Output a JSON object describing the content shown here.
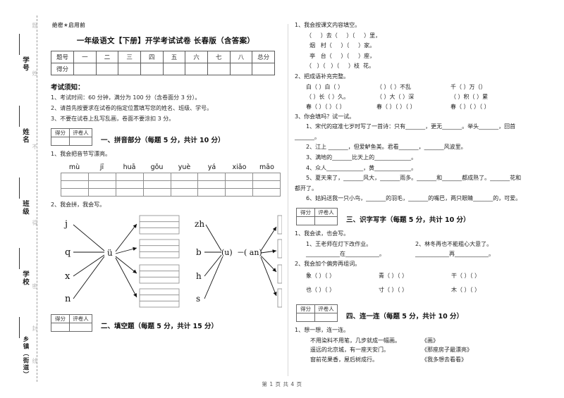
{
  "document": {
    "secret_mark": "绝密★启用前",
    "title": "一年级语文【下册】开学考试试卷 长春版（含答案）",
    "footer": "第 1 页 共 4 页"
  },
  "seal_column": {
    "labels": [
      "学号",
      "姓名",
      "班级",
      "学校",
      "乡镇（街道）"
    ],
    "faint": [
      "题",
      "姓",
      "不",
      "得",
      "密",
      "封",
      "线",
      "内",
      "答"
    ]
  },
  "score_table": {
    "row_labels": [
      "题号",
      "得分"
    ],
    "columns": [
      "一",
      "二",
      "三",
      "四",
      "五",
      "六",
      "七",
      "八",
      "总分"
    ]
  },
  "notice": {
    "title": "考试须知：",
    "items": [
      "1、考试时间：60 分钟，满分为 100 分（含卷面分 3 分）。",
      "2、请首先按要求在试卷的指定位置填写您的姓名、班级、学号。",
      "3、不要在试卷上乱写乱画，卷面不要涂扣 3 分。"
    ]
  },
  "grader_box": {
    "score_label": "得分",
    "grader_label": "评卷人"
  },
  "sections": [
    {
      "id": "s1",
      "title": "一、拼音部分（每题 5 分，共计 10 分）",
      "q1_label": "1、我会把音节写漂亮。",
      "pinyin": [
        "mù",
        "jī",
        "huā",
        "gǒu",
        "yuè",
        "yá",
        "xiǎo",
        "māo"
      ],
      "grid_cols": 8,
      "grid_rows": 3,
      "q2_label": "2、我会拼，我会写。",
      "diagram": {
        "left_group": {
          "initials": [
            "j",
            "q",
            "x",
            "n"
          ],
          "final": "ü",
          "boxes": 4
        },
        "right_group": {
          "initials": [
            "zh",
            "b",
            "h",
            "s"
          ],
          "middle": "(u)",
          "dash": "－",
          "final": "( an)",
          "boxes": 4
        }
      }
    },
    {
      "id": "s2",
      "title": "二、填空题（每题 5 分，共计 15 分）"
    },
    {
      "id": "s3",
      "title": "三、识字写字（每题 5 分，共计 10 分）",
      "q1_label": "1、我会读，也会写。",
      "sentences": [
        {
          "num": "1、",
          "text": "王老师在灯下改作业。",
          "blank": "____________在____________。"
        },
        {
          "num": "2、",
          "text": "林冬再也不能粗心大意了。",
          "blank": "____________再____________。"
        }
      ],
      "q2_label": "2、我会加个偏旁再组词。",
      "radical_rows": [
        [
          "象（  ）（      ）",
          "青（  ）（      ）",
          "干（  ）（      ）"
        ],
        [
          "也（  ）（      ）",
          "寸（  ）（      ）",
          "木（  ）（      ）"
        ]
      ]
    },
    {
      "id": "s4",
      "title": "四、连一连（每题 5 分，共计 10 分）",
      "q1_label": "1、想一想，连一连。",
      "pairs": [
        {
          "left": "不用染料不用笔，几步就成一幅画。",
          "right": "《画》"
        },
        {
          "left": "遥远的北京城，有一座天安门。",
          "right": "《那座房子最漂亮》"
        },
        {
          "left": "窗前花果香，屋后树成行。",
          "right": "《我多想去看看》"
        }
      ]
    }
  ],
  "right_column": {
    "q1_label": "1、我会按课文内容填空。",
    "poem_lines": [
      "（     ）去（     ）（     ）里，",
      "  烟   村（     ）（     ）家。",
      "  亭   台（     ）（     ）座，",
      "（   ）（   ）（     ）枝  花。"
    ],
    "q2_label": "2、把成语补充完整。",
    "idiom_rows": [
      [
        "白（  ）白（  ）",
        "（  ）（  ）不乱",
        "千（  ）万（）"
      ],
      [
        "（  ）长（  ）久。",
        "（  ）大（  ）深",
        "（  ）积（  ）累"
      ],
      [
        "春（  ）（  ）（  ）",
        "春（  ）（  ）（  ）",
        "春（  ）（  ）（  ）"
      ]
    ],
    "q3_label": "3、你会填吗？试一试。",
    "fill_items": [
      "1、宋代的寇准七岁时写了一首诗：只有_______，更无_______。举头_______，回首",
      "_______。",
      "2、江上 _______，但爱鲈鱼美。君看_______，_______风波里。",
      "3、满地的_______比天上的_____________。",
      "4、众人_____________，黄_____________。",
      "5、夏天来了，_______风大，_______雨多。_______和_______都成熟了。_______花和",
      "都开了。",
      "6、姑妈送我一只小鸟，_______的羽毛，_______的嘴巴，两只眼睛_______的，可爱。"
    ]
  }
}
